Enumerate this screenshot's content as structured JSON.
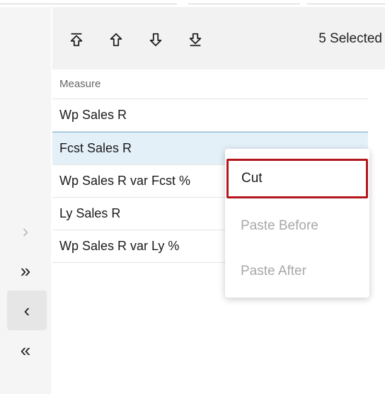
{
  "toolbar": {
    "move_top_icon": "move-to-top-icon",
    "move_up_icon": "move-up-icon",
    "move_down_icon": "move-down-icon",
    "move_bottom_icon": "move-to-bottom-icon",
    "selected_count": "5 Selected"
  },
  "side_controls": {
    "add_one": "›",
    "add_all": "»",
    "remove_one": "‹",
    "remove_all": "«"
  },
  "list": {
    "column_header": "Measure",
    "items": [
      {
        "label": "Wp Sales R",
        "selected": false
      },
      {
        "label": "Fcst Sales R",
        "selected": true
      },
      {
        "label": "Wp Sales R var Fcst %",
        "selected": false
      },
      {
        "label": "Ly Sales R",
        "selected": false
      },
      {
        "label": "Wp Sales R var Ly %",
        "selected": false
      }
    ]
  },
  "context_menu": {
    "items": [
      {
        "label": "Cut",
        "enabled": true,
        "highlighted": true
      },
      {
        "label": "Paste Before",
        "enabled": false
      },
      {
        "label": "Paste After",
        "enabled": false
      }
    ],
    "highlight_color": "#b3161c"
  },
  "colors": {
    "selected_row": "#e4f0f8",
    "selected_border": "#7fb8dd",
    "disabled_text": "#a8a8a8"
  }
}
